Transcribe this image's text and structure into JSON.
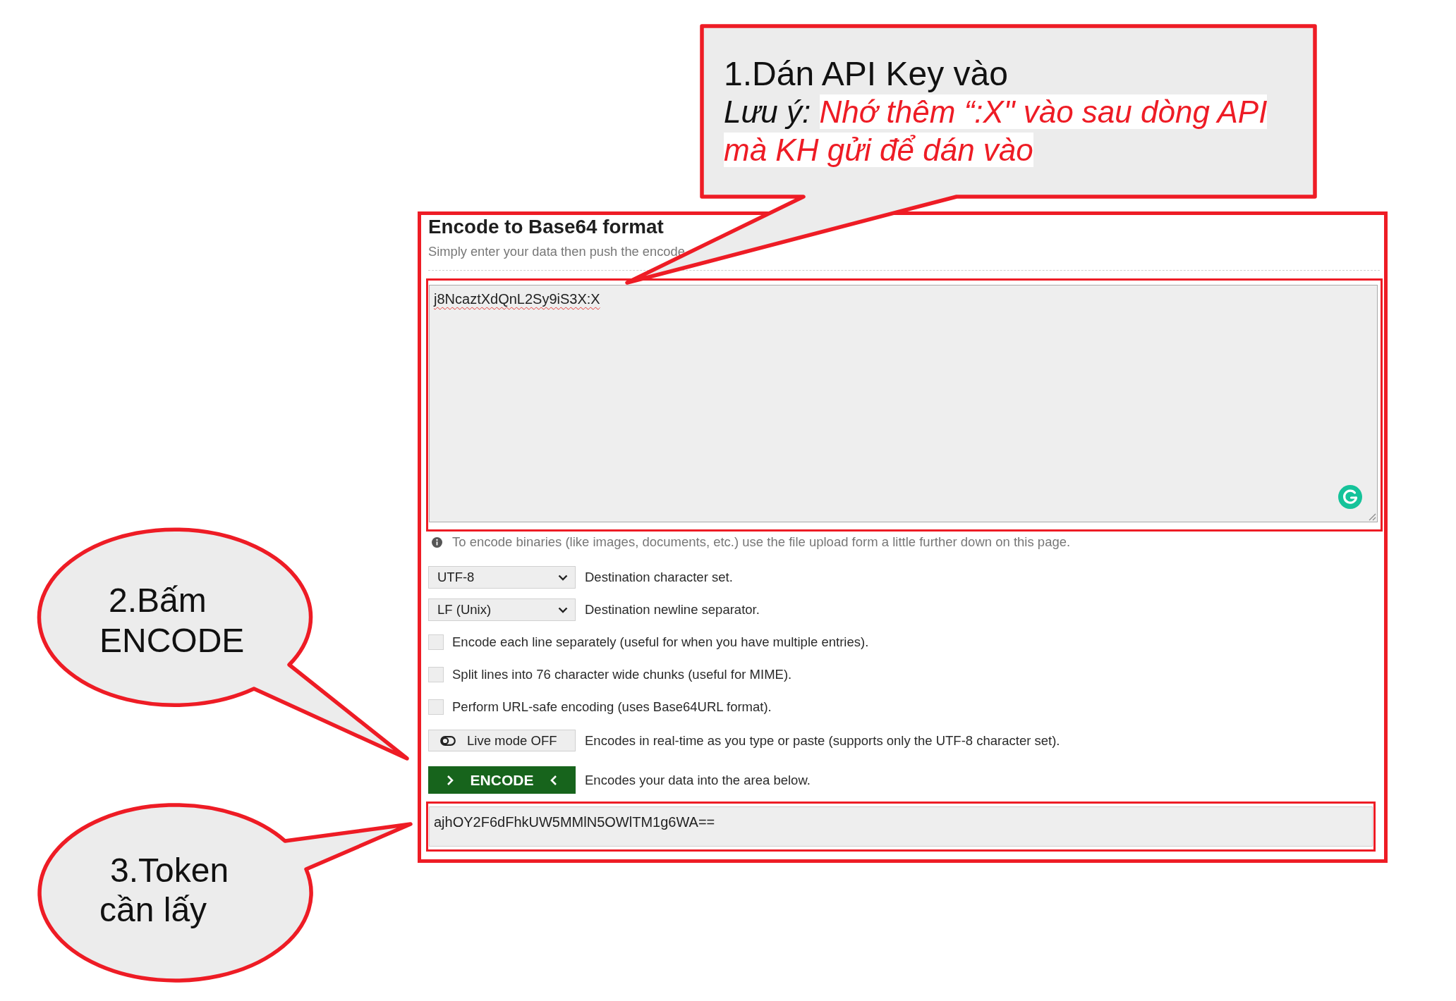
{
  "callouts": [
    {
      "kind": "box",
      "title": "1.Dán API Key vào",
      "note_label": "Lưu ý:",
      "note_lines": [
        "Nhớ thêm “:X\" vào sau dòng API",
        "mà KH gửi để dán vào"
      ]
    },
    {
      "kind": "bubble",
      "text": "2.Bấm ENCODE"
    },
    {
      "kind": "bubble",
      "text": "3.Token cần lấy"
    }
  ],
  "encoder": {
    "highlighted": true,
    "title": "Encode to Base64 format",
    "subtitle": "Simply enter your data then push the encode",
    "input": {
      "value": "j8NcaztXdQnL2Sy9iS3X:X",
      "highlighted": true
    },
    "info": "To encode binaries (like images, documents, etc.) use the file upload form a little further down on this page.",
    "selects": [
      {
        "value": "UTF-8",
        "description": "Destination character set."
      },
      {
        "value": "LF (Unix)",
        "description": "Destination newline separator."
      }
    ],
    "options": [
      {
        "label": "Encode each line separately (useful for when you have multiple entries).",
        "checked": false
      },
      {
        "label": "Split lines into 76 character wide chunks (useful for MIME).",
        "checked": false
      },
      {
        "label": "Perform URL-safe encoding (uses Base64URL format).",
        "checked": false
      }
    ],
    "live_mode": {
      "label": "Live mode OFF",
      "on": false,
      "description": "Encodes in real-time as you type or paste (supports only the UTF-8 character set)."
    },
    "encode_button": {
      "label": "ENCODE",
      "description": "Encodes your data into the area below."
    },
    "output": {
      "value": "ajhOY2F6dFhkUW5MMlN5OWlTM1g6WA==",
      "highlighted": true
    }
  }
}
